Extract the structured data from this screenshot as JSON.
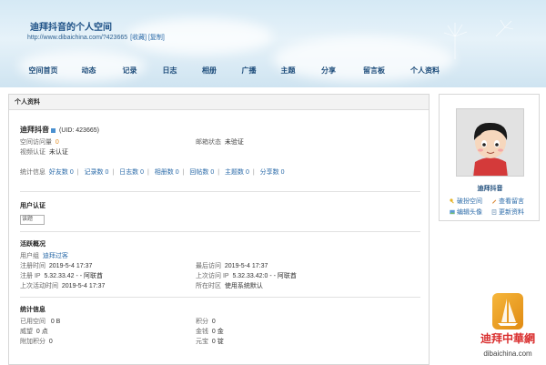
{
  "header": {
    "title": "迪拜抖音的个人空间",
    "url": "http://www.dibaichina.com/?423665",
    "bookmark_label": "[收藏]",
    "copy_label": "[复制]"
  },
  "nav": [
    "空间首页",
    "动态",
    "记录",
    "日志",
    "相册",
    "广播",
    "主题",
    "分享",
    "留言板",
    "个人资料"
  ],
  "panel": {
    "title": "个人资料",
    "username": "迪拜抖音",
    "uid": "(UID: 423665)",
    "visits_label": "空间访问量",
    "visits_value": "0",
    "video_label": "视频认证",
    "video_value": "未认证",
    "email_label": "邮箱状态",
    "email_value": "未验证",
    "stats": [
      {
        "label": "统计信息",
        "link": false
      },
      {
        "label": "好友数 0",
        "link": true
      },
      {
        "label": "记录数 0",
        "link": true
      },
      {
        "label": "日志数 0",
        "link": true
      },
      {
        "label": "相册数 0",
        "link": true
      },
      {
        "label": "回帖数 0",
        "link": true
      },
      {
        "label": "主题数 0",
        "link": true
      },
      {
        "label": "分享数 0",
        "link": true
      }
    ],
    "cert_title": "用户认证",
    "cert_img_alt": "该题",
    "active_title": "活跃概况",
    "group_label": "用户组",
    "group_value": "迪拜过客",
    "reg_label": "注册时间",
    "reg_value": "2019-5-4 17:37",
    "last_visit_label": "最后访问",
    "last_visit_value": "2019-5-4 17:37",
    "reg_ip_label": "注册 IP",
    "reg_ip_value": "5.32.33.42 - - 阿联酋",
    "last_ip_label": "上次访问 IP",
    "last_ip_value": "5.32.33.42:0 - - 阿联酋",
    "last_active_label": "上次活动时间",
    "last_active_value": "2019-5-4 17:37",
    "tz_label": "所在时区",
    "tz_value": "使用系统默认",
    "stat_title": "统计信息",
    "space_label": "已用空间",
    "space_value": "0 B",
    "points_label": "积分",
    "points_value": "0",
    "prestige_label": "威望",
    "prestige_value": "0 点",
    "money_label": "金钱",
    "money_value": "0 金",
    "extra_label": "附加积分",
    "extra_value": "0",
    "yuanbao_label": "元宝",
    "yuanbao_value": "0 锭"
  },
  "sidebar": {
    "name": "迪拜抖音",
    "links": [
      "破扮空间",
      "查看留言",
      "编辑头像",
      "更新资料"
    ]
  },
  "watermark": {
    "cn": "迪拜中華網",
    "en": "dibaichina.com"
  },
  "colors": {
    "link": "#2a6aa8",
    "nav": "#1e4d7b",
    "banner": "#d5e9f5",
    "watermark_red": "#d92c2c",
    "watermark_orange": "#f0a530"
  }
}
